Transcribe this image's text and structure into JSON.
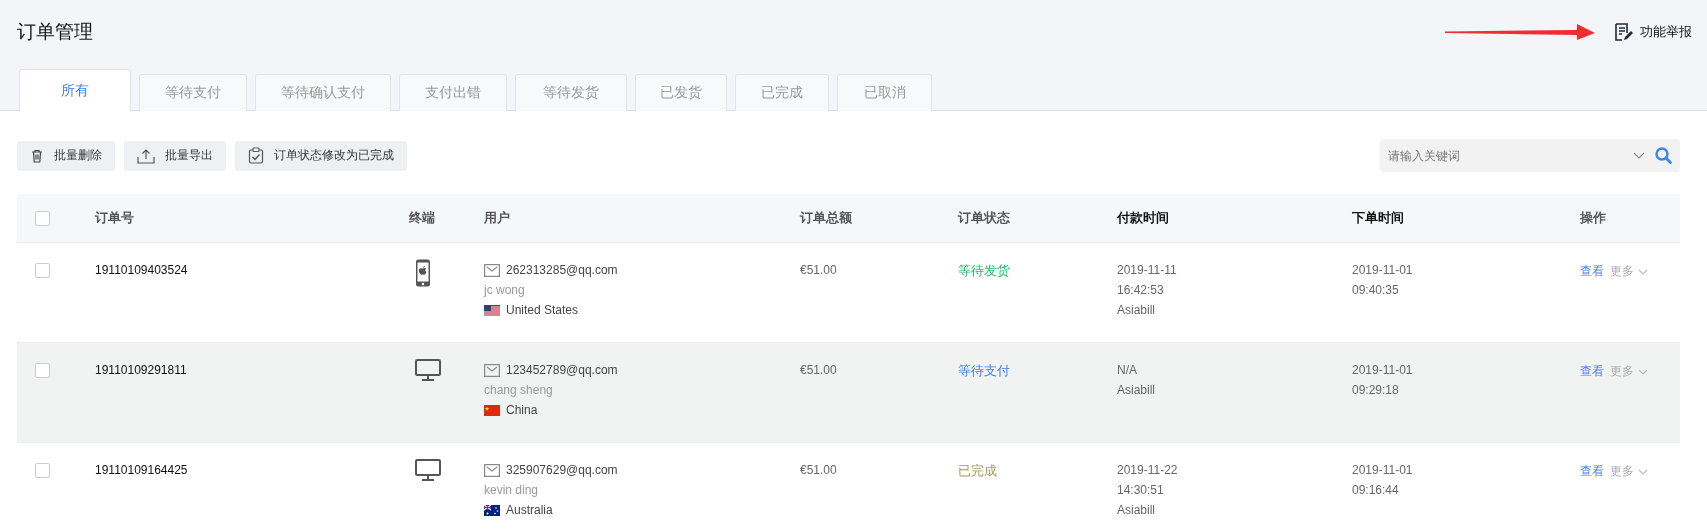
{
  "page": {
    "title": "订单管理"
  },
  "report_link": {
    "label": "功能举报"
  },
  "tabs": [
    {
      "label": "所有",
      "selected": true
    },
    {
      "label": "等待支付",
      "selected": false
    },
    {
      "label": "等待确认支付",
      "selected": false
    },
    {
      "label": "支付出错",
      "selected": false
    },
    {
      "label": "等待发货",
      "selected": false
    },
    {
      "label": "已发货",
      "selected": false
    },
    {
      "label": "已完成",
      "selected": false
    },
    {
      "label": "已取消",
      "selected": false
    }
  ],
  "toolbar": {
    "buttons": [
      {
        "label": "批量删除",
        "kind": "delete"
      },
      {
        "label": "批量导出",
        "kind": "export"
      },
      {
        "label": "订单状态修改为已完成",
        "kind": "complete"
      }
    ]
  },
  "search": {
    "placeholder": "请输入关键词"
  },
  "table": {
    "select_all": {
      "checked": false
    },
    "columns": [
      {
        "label": "订单号",
        "highlighted": false
      },
      {
        "label": "终端",
        "highlighted": false
      },
      {
        "label": "用户",
        "highlighted": false
      },
      {
        "label": "订单总额",
        "highlighted": false
      },
      {
        "label": "订单状态",
        "highlighted": false
      },
      {
        "label": "付款时间",
        "highlighted": true
      },
      {
        "label": "下单时间",
        "highlighted": true
      },
      {
        "label": "操作",
        "highlighted": false
      }
    ],
    "rows": [
      {
        "checked": false,
        "highlighted": false,
        "order_no": "19110109403524",
        "terminal": {
          "kind": "phone"
        },
        "email": "262313285@qq.com",
        "name": "jc wong",
        "flag": {
          "kind": "us"
        },
        "country": "United States",
        "amount": "€51.00",
        "status": {
          "text": "等待发货",
          "color": "#19be6b"
        },
        "paid": [
          "2019-11-11",
          "16:42:53",
          "Asiabill"
        ],
        "placed": [
          "2019-11-01",
          "09:40:35"
        ],
        "actions": [
          {
            "label": "查看",
            "kind": "link"
          },
          {
            "label": "更多",
            "kind": "menu"
          }
        ]
      },
      {
        "checked": false,
        "highlighted": true,
        "order_no": "19110109291811",
        "terminal": {
          "kind": "desktop"
        },
        "email": "123452789@qq.com",
        "name": "chang sheng",
        "flag": {
          "kind": "cn"
        },
        "country": "China",
        "amount": "€51.00",
        "status": {
          "text": "等待支付",
          "color": "#3f7fe0"
        },
        "paid": [
          "N/A",
          "Asiabill"
        ],
        "placed": [
          "2019-11-01",
          "09:29:18"
        ],
        "actions": [
          {
            "label": "查看",
            "kind": "link"
          },
          {
            "label": "更多",
            "kind": "menu"
          }
        ]
      },
      {
        "checked": false,
        "highlighted": false,
        "order_no": "19110109164425",
        "terminal": {
          "kind": "desktop"
        },
        "email": "325907629@qq.com",
        "name": "kevin ding",
        "flag": {
          "kind": "au"
        },
        "country": "Australia",
        "amount": "€51.00",
        "status": {
          "text": "已完成",
          "color": "#a09a5a"
        },
        "paid": [
          "2019-11-22",
          "14:30:51",
          "Asiabill"
        ],
        "placed": [
          "2019-11-01",
          "09:16:44"
        ],
        "actions": [
          {
            "label": "查看",
            "kind": "link"
          },
          {
            "label": "更多",
            "kind": "menu"
          }
        ]
      }
    ]
  }
}
